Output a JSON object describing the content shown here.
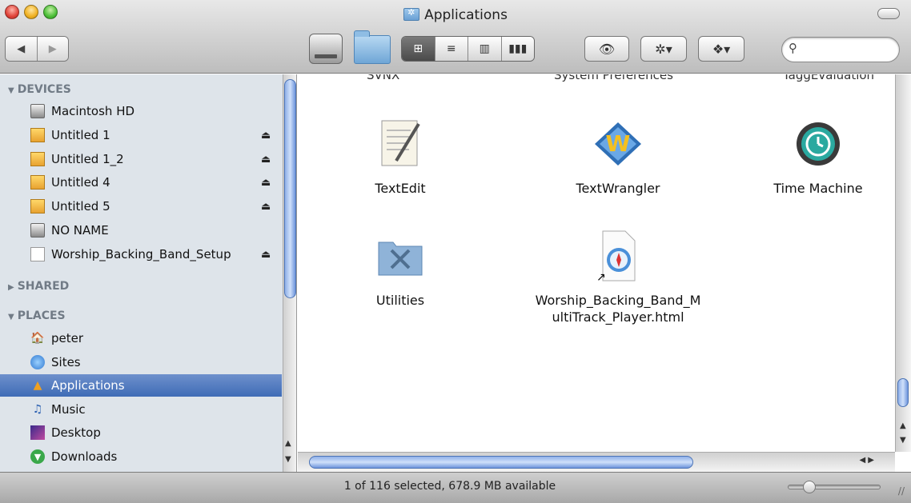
{
  "window": {
    "title": "Applications"
  },
  "toolbar": {
    "nav_back": "◀",
    "nav_forward": "▶",
    "view_buttons": [
      "⊞",
      "≡",
      "▥",
      "▮▮▮"
    ],
    "quicklook": "👁",
    "action": "✲▾",
    "dropbox": "❖▾",
    "search_placeholder": ""
  },
  "sidebar": {
    "devices_label": "DEVICES",
    "shared_label": "SHARED",
    "places_label": "PLACES",
    "devices": [
      {
        "label": "Macintosh HD",
        "icon": "hard-drive-icon",
        "eject": false
      },
      {
        "label": "Untitled 1",
        "icon": "disk-image-icon",
        "eject": true
      },
      {
        "label": "Untitled 1_2",
        "icon": "disk-image-icon",
        "eject": true
      },
      {
        "label": "Untitled 4",
        "icon": "disk-image-icon",
        "eject": true
      },
      {
        "label": "Untitled 5",
        "icon": "disk-image-icon",
        "eject": true
      },
      {
        "label": "NO NAME",
        "icon": "hard-drive-icon",
        "eject": false
      },
      {
        "label": "Worship_Backing_Band_Setup",
        "icon": "document-icon",
        "eject": true
      }
    ],
    "places": [
      {
        "label": "peter",
        "icon": "home-icon"
      },
      {
        "label": "Sites",
        "icon": "globe-icon"
      },
      {
        "label": "Applications",
        "icon": "applications-icon",
        "selected": true
      },
      {
        "label": "Music",
        "icon": "music-icon"
      },
      {
        "label": "Desktop",
        "icon": "desktop-icon"
      },
      {
        "label": "Downloads",
        "icon": "downloads-icon"
      }
    ],
    "eject_glyph": "⏏"
  },
  "content": {
    "partial_top_labels": [
      "SVNX",
      "System Preferences",
      "TaggEvaluation"
    ],
    "items": [
      {
        "label": "TextEdit",
        "icon": "textedit-icon"
      },
      {
        "label": "TextWrangler",
        "icon": "textwrangler-icon"
      },
      {
        "label": "Time Machine",
        "icon": "time-machine-icon"
      },
      {
        "label": "Utilities",
        "icon": "utilities-folder-icon"
      },
      {
        "label": "Worship_Backing_Band_M\nultiTrack_Player.html",
        "icon": "html-alias-icon"
      }
    ]
  },
  "status": {
    "text": "1 of 116 selected, 678.9 MB available"
  }
}
